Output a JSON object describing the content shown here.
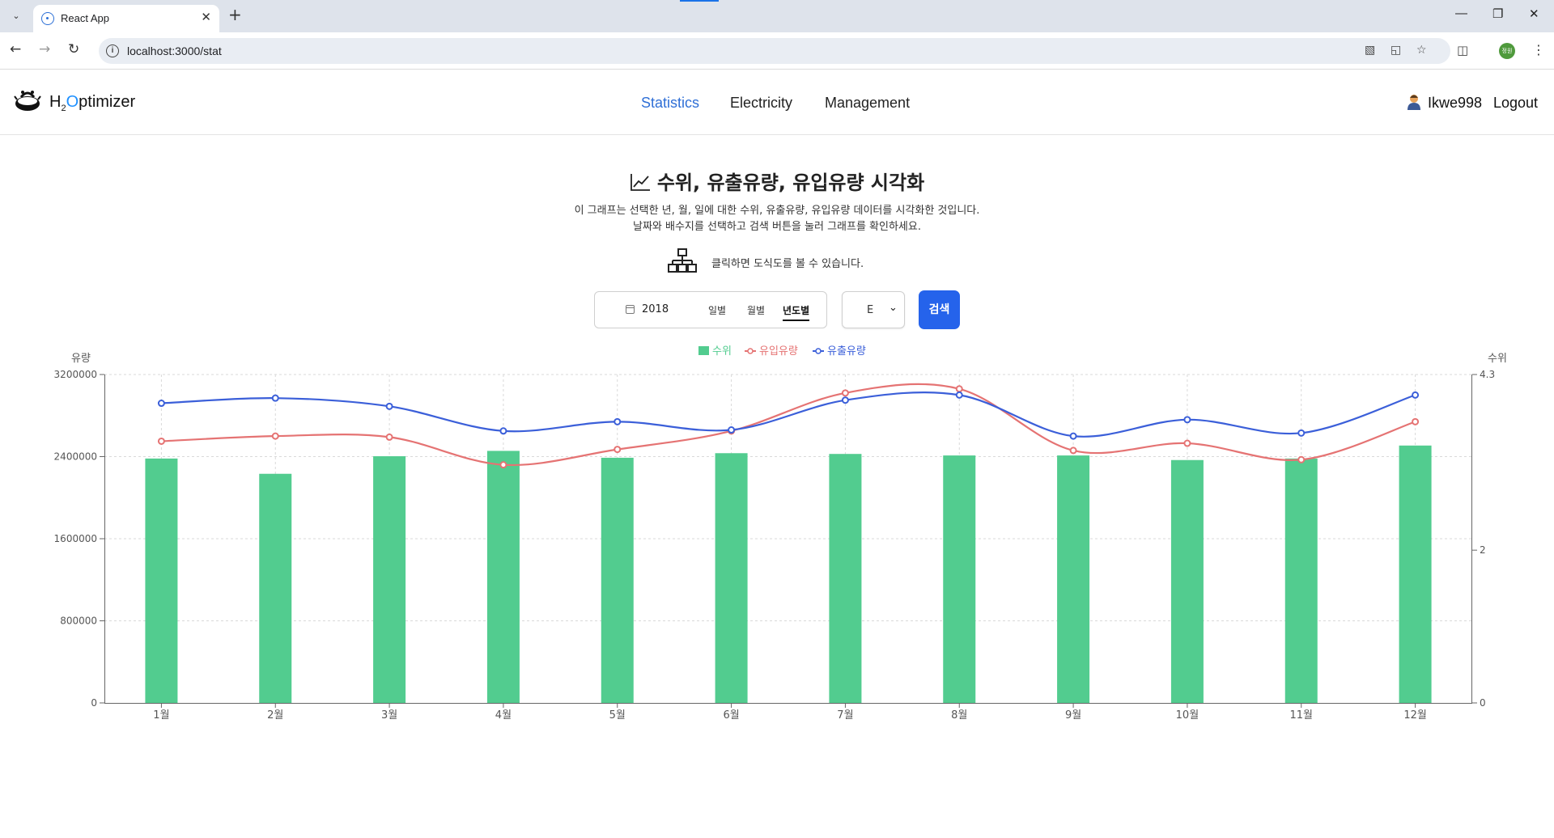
{
  "browser": {
    "tab_title": "React App",
    "url": "localhost:3000/stat",
    "profile_initials": "정원"
  },
  "header": {
    "logo_parts": {
      "h": "H",
      "sub": "2",
      "o": "O",
      "rest": "ptimizer"
    },
    "nav": [
      {
        "label": "Statistics",
        "active": true
      },
      {
        "label": "Electricity",
        "active": false
      },
      {
        "label": "Management",
        "active": false
      }
    ],
    "username": "Ikwe998",
    "logout_label": "Logout"
  },
  "page": {
    "title": "수위, 유출유량, 유입유량 시각화",
    "desc_line1": "이 그래프는 선택한 년, 월, 일에 대한 수위, 유출유량, 유입유량 데이터를 시각화한 것입니다.",
    "desc_line2": "날짜와 배수지를 선택하고 검색 버튼을 눌러 그래프를 확인하세요.",
    "diagram_hint": "클릭하면 도식도를 볼 수 있습니다."
  },
  "filter": {
    "year": "2018",
    "modes": [
      {
        "label": "일별",
        "active": false
      },
      {
        "label": "월별",
        "active": false
      },
      {
        "label": "년도별",
        "active": true
      }
    ],
    "site_value": "E",
    "search_label": "검색"
  },
  "colors": {
    "bar": "#52cc8f",
    "inflow": "#e57373",
    "outflow": "#3b5fd9",
    "accent": "#2563eb"
  },
  "chart_data": {
    "type": "bar",
    "categories": [
      "1월",
      "2월",
      "3월",
      "4월",
      "5월",
      "6월",
      "7월",
      "8월",
      "9월",
      "10월",
      "11월",
      "12월"
    ],
    "left_axis_label": "유량",
    "right_axis_label": "수위",
    "left_ylim": [
      0,
      3200000
    ],
    "left_ticks": [
      0,
      800000,
      1600000,
      2400000,
      3200000
    ],
    "right_ylim": [
      0,
      4.3
    ],
    "right_ticks": [
      "0",
      "2",
      "4.3"
    ],
    "right_tick_values": [
      0,
      2,
      4.3
    ],
    "grid": true,
    "legend_position": "top-center",
    "series": [
      {
        "name": "수위",
        "kind": "bar",
        "axis": "right",
        "color": "#52cc8f",
        "values": [
          3.2,
          3.0,
          3.23,
          3.3,
          3.21,
          3.27,
          3.26,
          3.24,
          3.24,
          3.18,
          3.2,
          3.37
        ]
      },
      {
        "name": "유입유량",
        "kind": "line",
        "axis": "left",
        "color": "#e57373",
        "values": [
          2550000,
          2600000,
          2590000,
          2320000,
          2470000,
          2650000,
          3020000,
          3060000,
          2460000,
          2530000,
          2370000,
          2740000
        ]
      },
      {
        "name": "유출유량",
        "kind": "line",
        "axis": "left",
        "color": "#3b5fd9",
        "values": [
          2920000,
          2970000,
          2890000,
          2650000,
          2740000,
          2660000,
          2950000,
          3000000,
          2600000,
          2760000,
          2630000,
          3000000
        ]
      }
    ]
  }
}
